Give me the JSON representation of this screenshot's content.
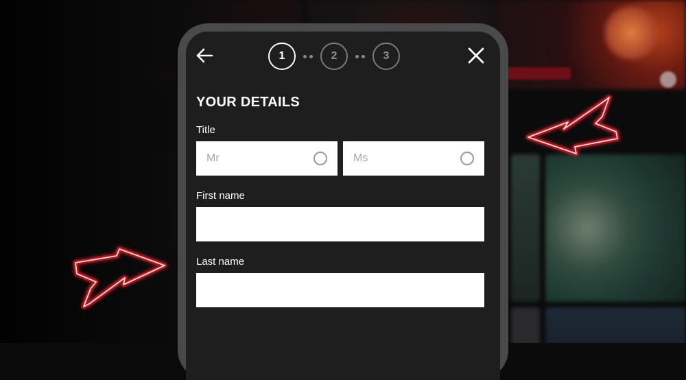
{
  "wizard": {
    "steps": [
      {
        "number": "1",
        "active": true
      },
      {
        "number": "2",
        "active": false
      },
      {
        "number": "3",
        "active": false
      }
    ],
    "back_icon": "arrow-left-icon",
    "close_icon": "close-icon"
  },
  "form": {
    "heading": "YOUR DETAILS",
    "title_label": "Title",
    "title_options": [
      {
        "label": "Mr",
        "selected": false
      },
      {
        "label": "Ms",
        "selected": false
      }
    ],
    "first_name_label": "First name",
    "first_name_value": "",
    "last_name_label": "Last name",
    "last_name_value": ""
  },
  "colors": {
    "screen_bg": "#1e1e1e",
    "phone_frame": "#4a4a4a",
    "neon_arrow": "#e0212b",
    "text_white": "#ffffff",
    "placeholder_gray": "#a7a7a7"
  }
}
